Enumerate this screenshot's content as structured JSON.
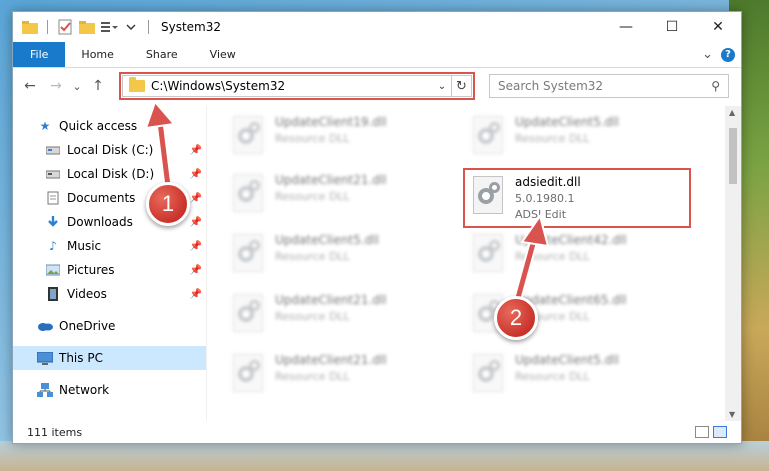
{
  "window": {
    "title": "System32"
  },
  "qat": {
    "icons": [
      "folder-icon",
      "properties-icon",
      "new-folder-icon",
      "customize-icon"
    ]
  },
  "window_controls": {
    "minimize": "—",
    "maximize": "☐",
    "close": "✕"
  },
  "ribbon": {
    "tabs": [
      "File",
      "Home",
      "Share",
      "View"
    ],
    "expand": "⌄",
    "help": "?"
  },
  "address": {
    "path": "C:\\Windows\\System32",
    "back": "←",
    "forward": "→",
    "recent": "⌄",
    "up": "↑",
    "dropdown": "⌄",
    "refresh": "↻"
  },
  "search": {
    "placeholder": "Search System32",
    "icon": "⚲"
  },
  "nav": {
    "quick_access": "Quick access",
    "items": [
      {
        "label": "Local Disk (C:)",
        "icon": "drive-icon",
        "pinned": true
      },
      {
        "label": "Local Disk (D:)",
        "icon": "drive-icon",
        "pinned": true
      },
      {
        "label": "Documents",
        "icon": "documents-icon",
        "pinned": true
      },
      {
        "label": "Downloads",
        "icon": "downloads-icon",
        "pinned": true
      },
      {
        "label": "Music",
        "icon": "music-icon",
        "pinned": true
      },
      {
        "label": "Pictures",
        "icon": "pictures-icon",
        "pinned": true
      },
      {
        "label": "Videos",
        "icon": "videos-icon",
        "pinned": true
      }
    ],
    "onedrive": "OneDrive",
    "thispc": "This PC",
    "network": "Network",
    "pin_glyph": "📌"
  },
  "files": {
    "left_column": [
      {
        "name": "UpdateClient19.dll",
        "desc": "Resource DLL"
      },
      {
        "name": "UpdateClient21.dll",
        "desc": "Resource DLL"
      },
      {
        "name": "UpdateClient5.dll",
        "desc": "Resource DLL"
      },
      {
        "name": "UpdateClient21.dll",
        "desc": "Resource DLL"
      },
      {
        "name": "UpdateClient21.dll",
        "desc": "Resource DLL"
      }
    ],
    "right_column": [
      {
        "name": "UpdateClient5.dll",
        "desc": "Resource DLL"
      },
      {
        "name": "UpdateClient42.dll",
        "desc": "Resource DLL"
      },
      {
        "name": "UpdateClient65.dll",
        "desc": "Resource DLL"
      },
      {
        "name": "UpdateClient5.dll",
        "desc": "Resource DLL"
      }
    ],
    "highlighted": {
      "name": "adsiedit.dll",
      "version": "5.0.1980.1",
      "desc": "ADSI Edit"
    }
  },
  "status": {
    "items_count": "111 items"
  },
  "callouts": {
    "one": "1",
    "two": "2"
  },
  "colors": {
    "accent": "#1979ca",
    "highlight": "#d9534f",
    "selected": "#cce8ff"
  }
}
